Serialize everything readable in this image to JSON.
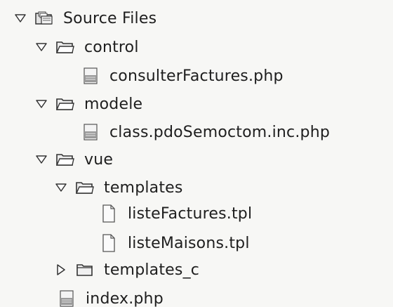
{
  "tree": {
    "root": {
      "label": "Source Files",
      "expanded": true,
      "icon": "source-folder-icon"
    },
    "control": {
      "label": "control",
      "expanded": true,
      "icon": "folder-open-icon",
      "files": [
        {
          "label": "consulterFactures.php",
          "icon": "php-file-icon"
        }
      ]
    },
    "modele": {
      "label": "modele",
      "expanded": true,
      "icon": "folder-open-icon",
      "files": [
        {
          "label": "class.pdoSemoctom.inc.php",
          "icon": "php-file-icon"
        }
      ]
    },
    "vue": {
      "label": "vue",
      "expanded": true,
      "icon": "folder-open-icon",
      "templates": {
        "label": "templates",
        "expanded": true,
        "icon": "folder-open-icon",
        "files": [
          {
            "label": "listeFactures.tpl",
            "icon": "tpl-file-icon"
          },
          {
            "label": "listeMaisons.tpl",
            "icon": "tpl-file-icon"
          }
        ]
      },
      "templates_c": {
        "label": "templates_c",
        "expanded": false,
        "icon": "folder-closed-icon"
      }
    },
    "index": {
      "label": "index.php",
      "icon": "php-file-icon"
    }
  }
}
